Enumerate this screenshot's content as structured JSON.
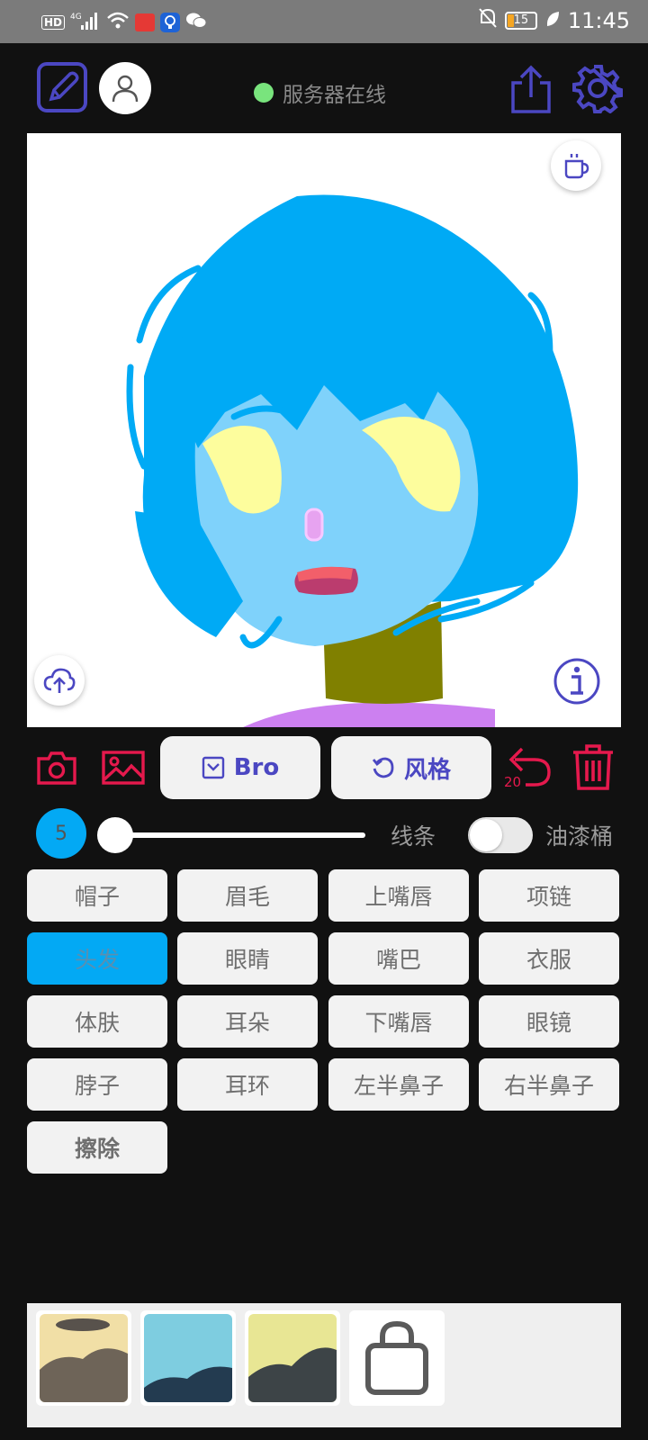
{
  "status_bar": {
    "left_icons": [
      "hd-icon",
      "4g-signal-icon",
      "wifi-icon",
      "app-notification-icon",
      "bulb-app-icon",
      "wechat-icon"
    ],
    "hd_label": "HD",
    "network_label": "4G",
    "battery_level": "15",
    "time": "11:45"
  },
  "header": {
    "server_status": "服务器在线",
    "server_status_color": "#79e47d"
  },
  "toolbar": {
    "template_label": "Bro",
    "style_label": "风格",
    "undo_count": "20",
    "accent_color": "#e5194d",
    "primary_color": "#4b47c2"
  },
  "brush": {
    "size": "5",
    "size_fraction": 0.0,
    "line_label": "线条",
    "fill_label": "油漆桶",
    "fill_enabled": false
  },
  "categories": [
    {
      "label": "帽子",
      "active": false
    },
    {
      "label": "眉毛",
      "active": false
    },
    {
      "label": "上嘴唇",
      "active": false
    },
    {
      "label": "项链",
      "active": false
    },
    {
      "label": "头发",
      "active": true
    },
    {
      "label": "眼睛",
      "active": false
    },
    {
      "label": "嘴巴",
      "active": false
    },
    {
      "label": "衣服",
      "active": false
    },
    {
      "label": "体肤",
      "active": false
    },
    {
      "label": "耳朵",
      "active": false
    },
    {
      "label": "下嘴唇",
      "active": false
    },
    {
      "label": "眼镜",
      "active": false
    },
    {
      "label": "脖子",
      "active": false
    },
    {
      "label": "耳环",
      "active": false
    },
    {
      "label": "左半鼻子",
      "active": false
    },
    {
      "label": "右半鼻子",
      "active": false
    },
    {
      "label": "擦除",
      "active": false
    }
  ],
  "active_color": "#03a9f4"
}
